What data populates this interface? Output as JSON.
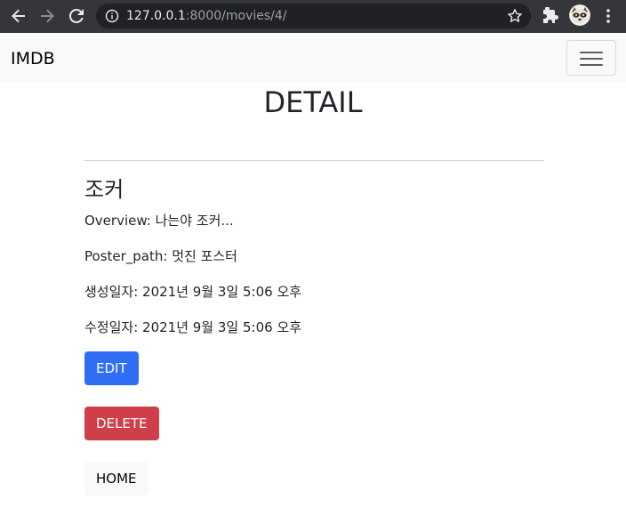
{
  "browser": {
    "url_host": "127.0.0.1",
    "url_rest": ":8000/movies/4/"
  },
  "navbar": {
    "brand": "IMDB",
    "toggler_icon": "hamburger-icon"
  },
  "page": {
    "title": "DETAIL"
  },
  "movie": {
    "title": "조커",
    "overview": "Overview: 나는야 조커...",
    "poster_path": "Poster_path: 멋진 포스터",
    "created": "생성일자: 2021년 9월 3일 5:06 오후",
    "updated": "수정일자: 2021년 9월 3일 5:06 오후"
  },
  "buttons": {
    "edit": "EDIT",
    "delete": "DELETE",
    "home": "HOME"
  },
  "colors": {
    "edit": "#2f6ef5",
    "delete": "#cf3f49",
    "navbar_bg": "#f8f9fa",
    "chrome_bg": "#35363a"
  }
}
